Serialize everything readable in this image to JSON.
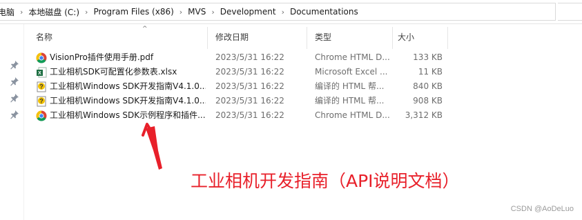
{
  "breadcrumb": [
    "电脑",
    "本地磁盘 (C:)",
    "Program Files (x86)",
    "MVS",
    "Development",
    "Documentations"
  ],
  "columns": {
    "name": "名称",
    "date": "修改日期",
    "type": "类型",
    "size": "大小"
  },
  "files": [
    {
      "name": "VisionPro插件使用手册.pdf",
      "date": "2023/5/31 16:22",
      "type": "Chrome HTML D...",
      "size": "133 KB",
      "icon": "chrome-icon"
    },
    {
      "name": "工业相机SDK可配置化参数表.xlsx",
      "date": "2023/5/31 16:22",
      "type": "Microsoft Excel ...",
      "size": "11 KB",
      "icon": "excel-icon"
    },
    {
      "name": "工业相机Windows SDK开发指南V4.1.0...",
      "date": "2023/5/31 16:22",
      "type": "编译的 HTML 帮...",
      "size": "840 KB",
      "icon": "chm-help-icon"
    },
    {
      "name": "工业相机Windows SDK开发指南V4.1.0...",
      "date": "2023/5/31 16:22",
      "type": "编译的 HTML 帮...",
      "size": "908 KB",
      "icon": "chm-help-icon"
    },
    {
      "name": "工业相机Windows SDK示例程序和插件...",
      "date": "2023/5/31 16:22",
      "type": "Chrome HTML D...",
      "size": "3,312 KB",
      "icon": "chrome-icon"
    }
  ],
  "annotation": "工业相机开发指南（API说明文档）",
  "watermark": "CSDN @AoDeLuo",
  "colors": {
    "annotation_red": "#e8202a",
    "excel_green": "#1d6f42",
    "chm_yellow": "#f2c200"
  }
}
